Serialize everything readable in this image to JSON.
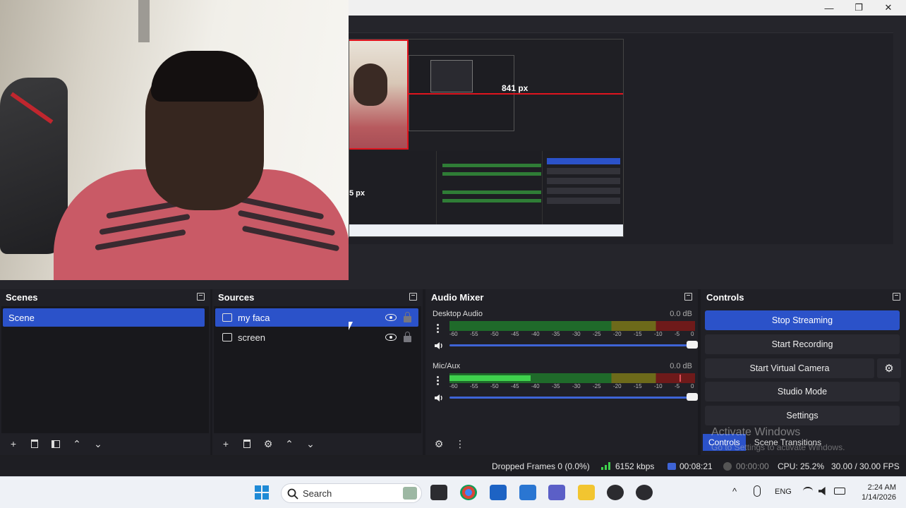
{
  "window": {
    "minimize_glyph": "—",
    "maximize_glyph": "❐",
    "close_glyph": "✕"
  },
  "preview": {
    "nested_px_label": "841 px",
    "nested_px_label_left": "5 px"
  },
  "scenes": {
    "title": "Scenes",
    "items": [
      {
        "label": "Scene",
        "selected": true
      }
    ],
    "toolbar": {
      "add": "+",
      "remove": "🗑",
      "filter": "▤",
      "up": "⌃",
      "down": "⌄"
    }
  },
  "sources": {
    "title": "Sources",
    "items": [
      {
        "label": "my faca",
        "type": "camera-icon",
        "selected": true
      },
      {
        "label": "screen",
        "type": "monitor-icon",
        "selected": false
      }
    ],
    "toolbar": {
      "add": "+",
      "remove": "🗑",
      "settings": "⚙",
      "up": "⌃",
      "down": "⌄"
    }
  },
  "audio_mixer": {
    "title": "Audio Mixer",
    "channels": [
      {
        "name": "Desktop Audio",
        "db": "0.0 dB",
        "level": 0.0
      },
      {
        "name": "Mic/Aux",
        "db": "0.0 dB",
        "level": 0.33
      }
    ],
    "ticks": [
      "-60",
      "-55",
      "-50",
      "-45",
      "-40",
      "-35",
      "-30",
      "-25",
      "-20",
      "-15",
      "-10",
      "-5",
      "0"
    ],
    "toolbar": {
      "advanced": "⚙",
      "menu": "⋮"
    }
  },
  "controls": {
    "title": "Controls",
    "buttons": {
      "stop_streaming": "Stop Streaming",
      "start_recording": "Start Recording",
      "start_virtual_camera": "Start Virtual Camera",
      "studio_mode": "Studio Mode",
      "settings": "Settings"
    },
    "gear": "⚙"
  },
  "dock_tabs": {
    "controls": "Controls",
    "scene_transitions": "Scene Transitions"
  },
  "activation": {
    "title": "Activate Windows",
    "subtitle": "Go to Settings to activate Windows."
  },
  "status": {
    "dropped_frames": "Dropped Frames 0 (0.0%)",
    "bitrate": "6152 kbps",
    "stream_time": "00:08:21",
    "record_time": "00:00:00",
    "cpu": "CPU: 25.2%",
    "fps": "30.00 / 30.00 FPS"
  },
  "taskbar": {
    "search_placeholder": "Search",
    "language": "ENG",
    "time": "2:24 AM",
    "date": "1/14/2026",
    "chevron": "^"
  },
  "colors": {
    "accent": "#2b52c9",
    "panel": "#202026",
    "background": "#1a1a1f"
  }
}
